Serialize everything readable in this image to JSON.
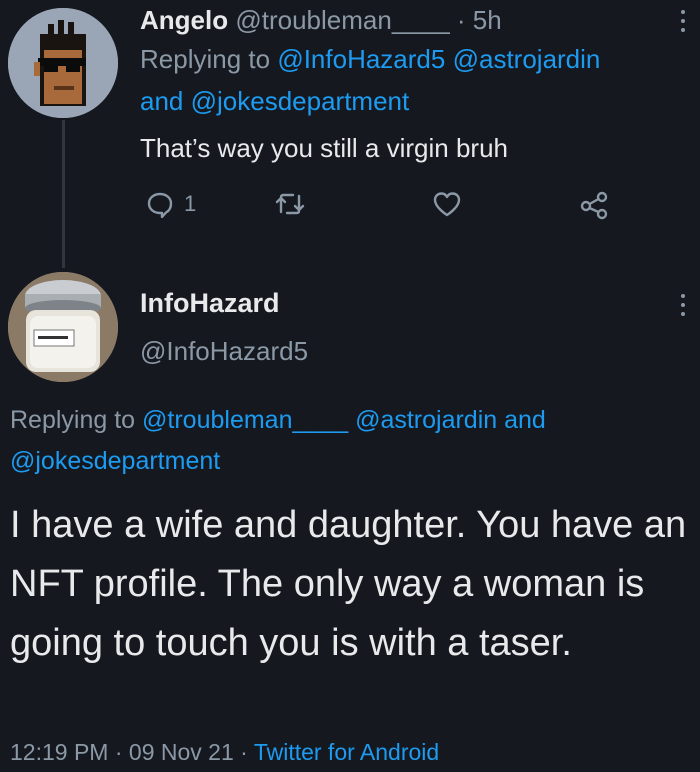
{
  "tweet1": {
    "name": "Angelo",
    "handle": "@troubleman____",
    "time": "5h",
    "replying_prefix": "Replying to",
    "replying_handle_1": "@InfoHazard5",
    "replying_handle_2": "@astrojardin",
    "replying_and": "and",
    "replying_handle_3": "@jokesdepartment",
    "text": "That’s way you still a virgin bruh",
    "reply_count": "1",
    "retweet_count": "",
    "like_count": ""
  },
  "tweet2": {
    "name": "InfoHazard",
    "handle": "@InfoHazard5",
    "replying_prefix": "Replying to",
    "replying_handle_1": "@troubleman____",
    "replying_handle_2": "@astrojardin",
    "replying_and": "and",
    "replying_handle_3": "@jokesdepartment",
    "text": "I have a wife and daughter. You have an NFT profile. The only way a woman is going to touch you is with a taser.",
    "time": "12:19 PM",
    "date": "09 Nov 21",
    "source": "Twitter for Android"
  },
  "icons": {
    "reply": "comment-icon",
    "retweet": "retweet-icon",
    "like": "heart-icon",
    "share": "share-icon",
    "more": "more-options-icon"
  },
  "colors": {
    "background": "#15181f",
    "text": "#e7e9ea",
    "muted": "#8b98a5",
    "link": "#1d9bf0"
  }
}
